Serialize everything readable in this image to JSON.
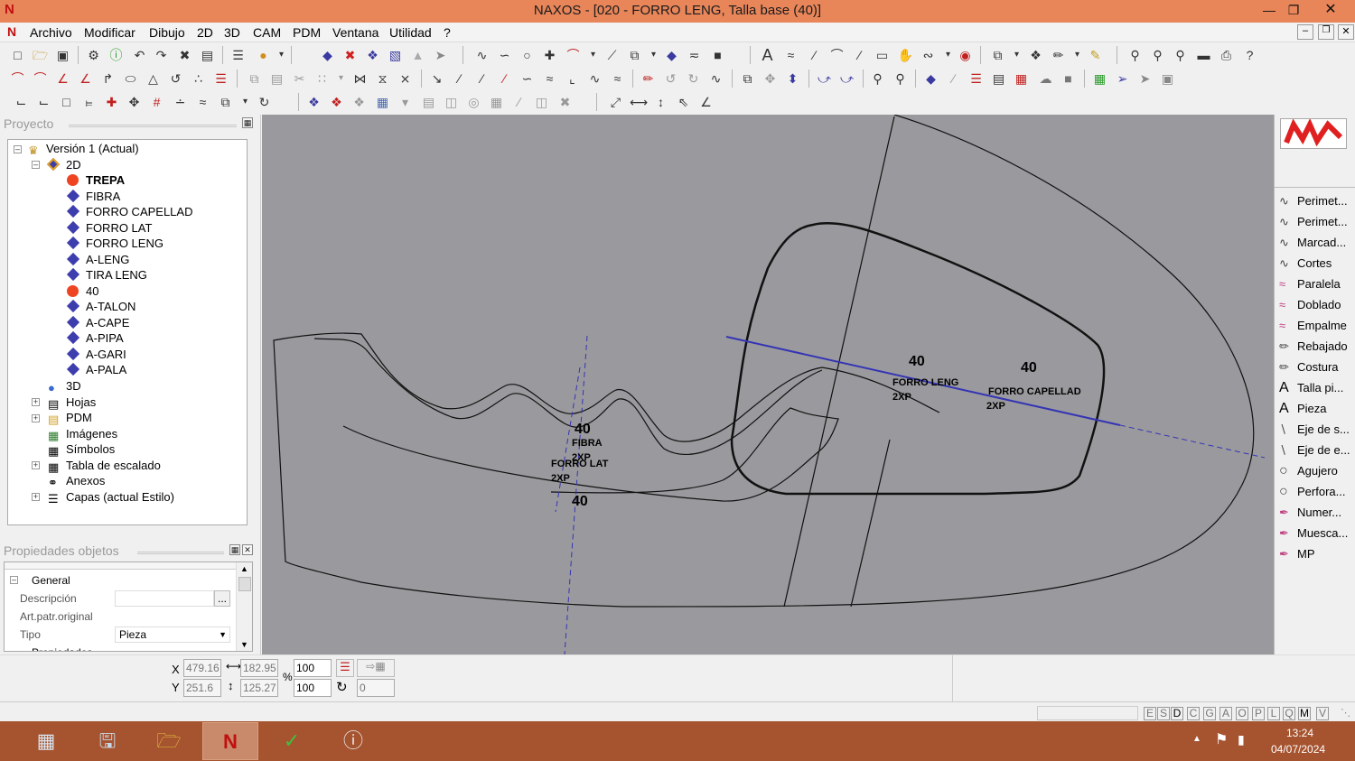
{
  "window": {
    "title": "NAXOS - [020 - FORRO LENG, Talla base (40)]",
    "app_icon": "N"
  },
  "menus": [
    "Archivo",
    "Modificar",
    "Dibujo",
    "2D",
    "3D",
    "CAM",
    "PDM",
    "Ventana",
    "Utilidad",
    "?"
  ],
  "project_panel": {
    "title": "Proyecto",
    "tree": [
      {
        "label": "Versión 1 (Actual)",
        "icon": "version-icon"
      },
      {
        "label": "2D",
        "icon": "diamond-icon"
      },
      {
        "label": "TREPA",
        "icon": "red-dot-icon",
        "bold": true
      },
      {
        "label": "FIBRA",
        "icon": "diamond-icon"
      },
      {
        "label": "FORRO CAPELLAD",
        "icon": "diamond-icon"
      },
      {
        "label": "FORRO LAT",
        "icon": "diamond-icon"
      },
      {
        "label": "FORRO LENG",
        "icon": "diamond-icon"
      },
      {
        "label": "A-LENG",
        "icon": "diamond-icon"
      },
      {
        "label": "TIRA LENG",
        "icon": "diamond-icon"
      },
      {
        "label": "40",
        "icon": "red-dot-icon"
      },
      {
        "label": "A-TALON",
        "icon": "diamond-icon"
      },
      {
        "label": "A-CAPE",
        "icon": "diamond-icon"
      },
      {
        "label": "A-PIPA",
        "icon": "diamond-icon"
      },
      {
        "label": "A-GARI",
        "icon": "diamond-icon"
      },
      {
        "label": "A-PALA",
        "icon": "diamond-icon"
      },
      {
        "label": "3D",
        "icon": "sphere-icon"
      },
      {
        "label": "Hojas",
        "icon": "sheet-icon"
      },
      {
        "label": "PDM",
        "icon": "folder-icon"
      },
      {
        "label": "Imágenes",
        "icon": "image-icon"
      },
      {
        "label": "Símbolos",
        "icon": "symbol-icon"
      },
      {
        "label": "Tabla de escalado",
        "icon": "table-icon"
      },
      {
        "label": "Anexos",
        "icon": "clip-icon"
      },
      {
        "label": "Capas (actual Estilo)",
        "icon": "layers-icon"
      }
    ]
  },
  "properties_panel": {
    "title": "Propiedades objetos",
    "section": "General",
    "rows": [
      {
        "label": "Descripción",
        "value": "",
        "button": "..."
      },
      {
        "label": "Art.patr.original",
        "value": ""
      },
      {
        "label": "Tipo",
        "value": "Pieza"
      },
      {
        "label": "Propiedades",
        "value": ""
      }
    ]
  },
  "canvas": {
    "labels": {
      "size_a": "40",
      "fibra": "FIBRA",
      "fibra_qty": "2XP",
      "forro_lat": "FORRO LAT",
      "forro_lat_qty": "2XP",
      "size_b": "40",
      "size_c": "40",
      "forro_leng": "FORRO LENG",
      "forro_leng_qty": "2XP",
      "size_d": "40",
      "forro_capellad": "FORRO CAPELLAD",
      "forro_capellad_qty": "2XP"
    }
  },
  "right_tools": [
    {
      "label": "Perimet...",
      "icon": "curve-icon"
    },
    {
      "label": "Perimet...",
      "icon": "curve-icon"
    },
    {
      "label": "Marcad...",
      "icon": "curve-icon"
    },
    {
      "label": "Cortes",
      "icon": "curve-icon"
    },
    {
      "label": "Paralela",
      "icon": "parallel-icon"
    },
    {
      "label": "Doblado",
      "icon": "parallel-icon"
    },
    {
      "label": "Empalme",
      "icon": "parallel-icon"
    },
    {
      "label": "Rebajado",
      "icon": "pencil-icon"
    },
    {
      "label": "Costura",
      "icon": "pencil-icon"
    },
    {
      "label": "Talla pi...",
      "icon": "text-a-icon"
    },
    {
      "label": "Pieza",
      "icon": "text-a-icon"
    },
    {
      "label": "Eje de s...",
      "icon": "axis-icon"
    },
    {
      "label": "Eje de e...",
      "icon": "axis-icon"
    },
    {
      "label": "Agujero",
      "icon": "circle-icon"
    },
    {
      "label": "Perfora...",
      "icon": "circle-icon"
    },
    {
      "label": "Numer...",
      "icon": "pen-icon"
    },
    {
      "label": "Muesca...",
      "icon": "pen-icon"
    },
    {
      "label": "MP",
      "icon": "pen-icon"
    }
  ],
  "coords": {
    "x_label": "X",
    "y_label": "Y",
    "x": "479.16",
    "y": "251.6",
    "w": "182.95",
    "h": "125.27",
    "scale_x": "100",
    "scale_y": "100",
    "percent": "%",
    "rotation": "0"
  },
  "status_flags": [
    "E",
    "S",
    "D",
    "C",
    "G",
    "A",
    "O",
    "P",
    "L",
    "Q",
    "M",
    "V"
  ],
  "taskbar": {
    "time": "13:24",
    "date": "04/07/2024"
  },
  "colors": {
    "titlebar": "#e8865a",
    "taskbar": "#a6532f",
    "canvas": "#9a9a9e",
    "axis_line": "#3434b4"
  }
}
